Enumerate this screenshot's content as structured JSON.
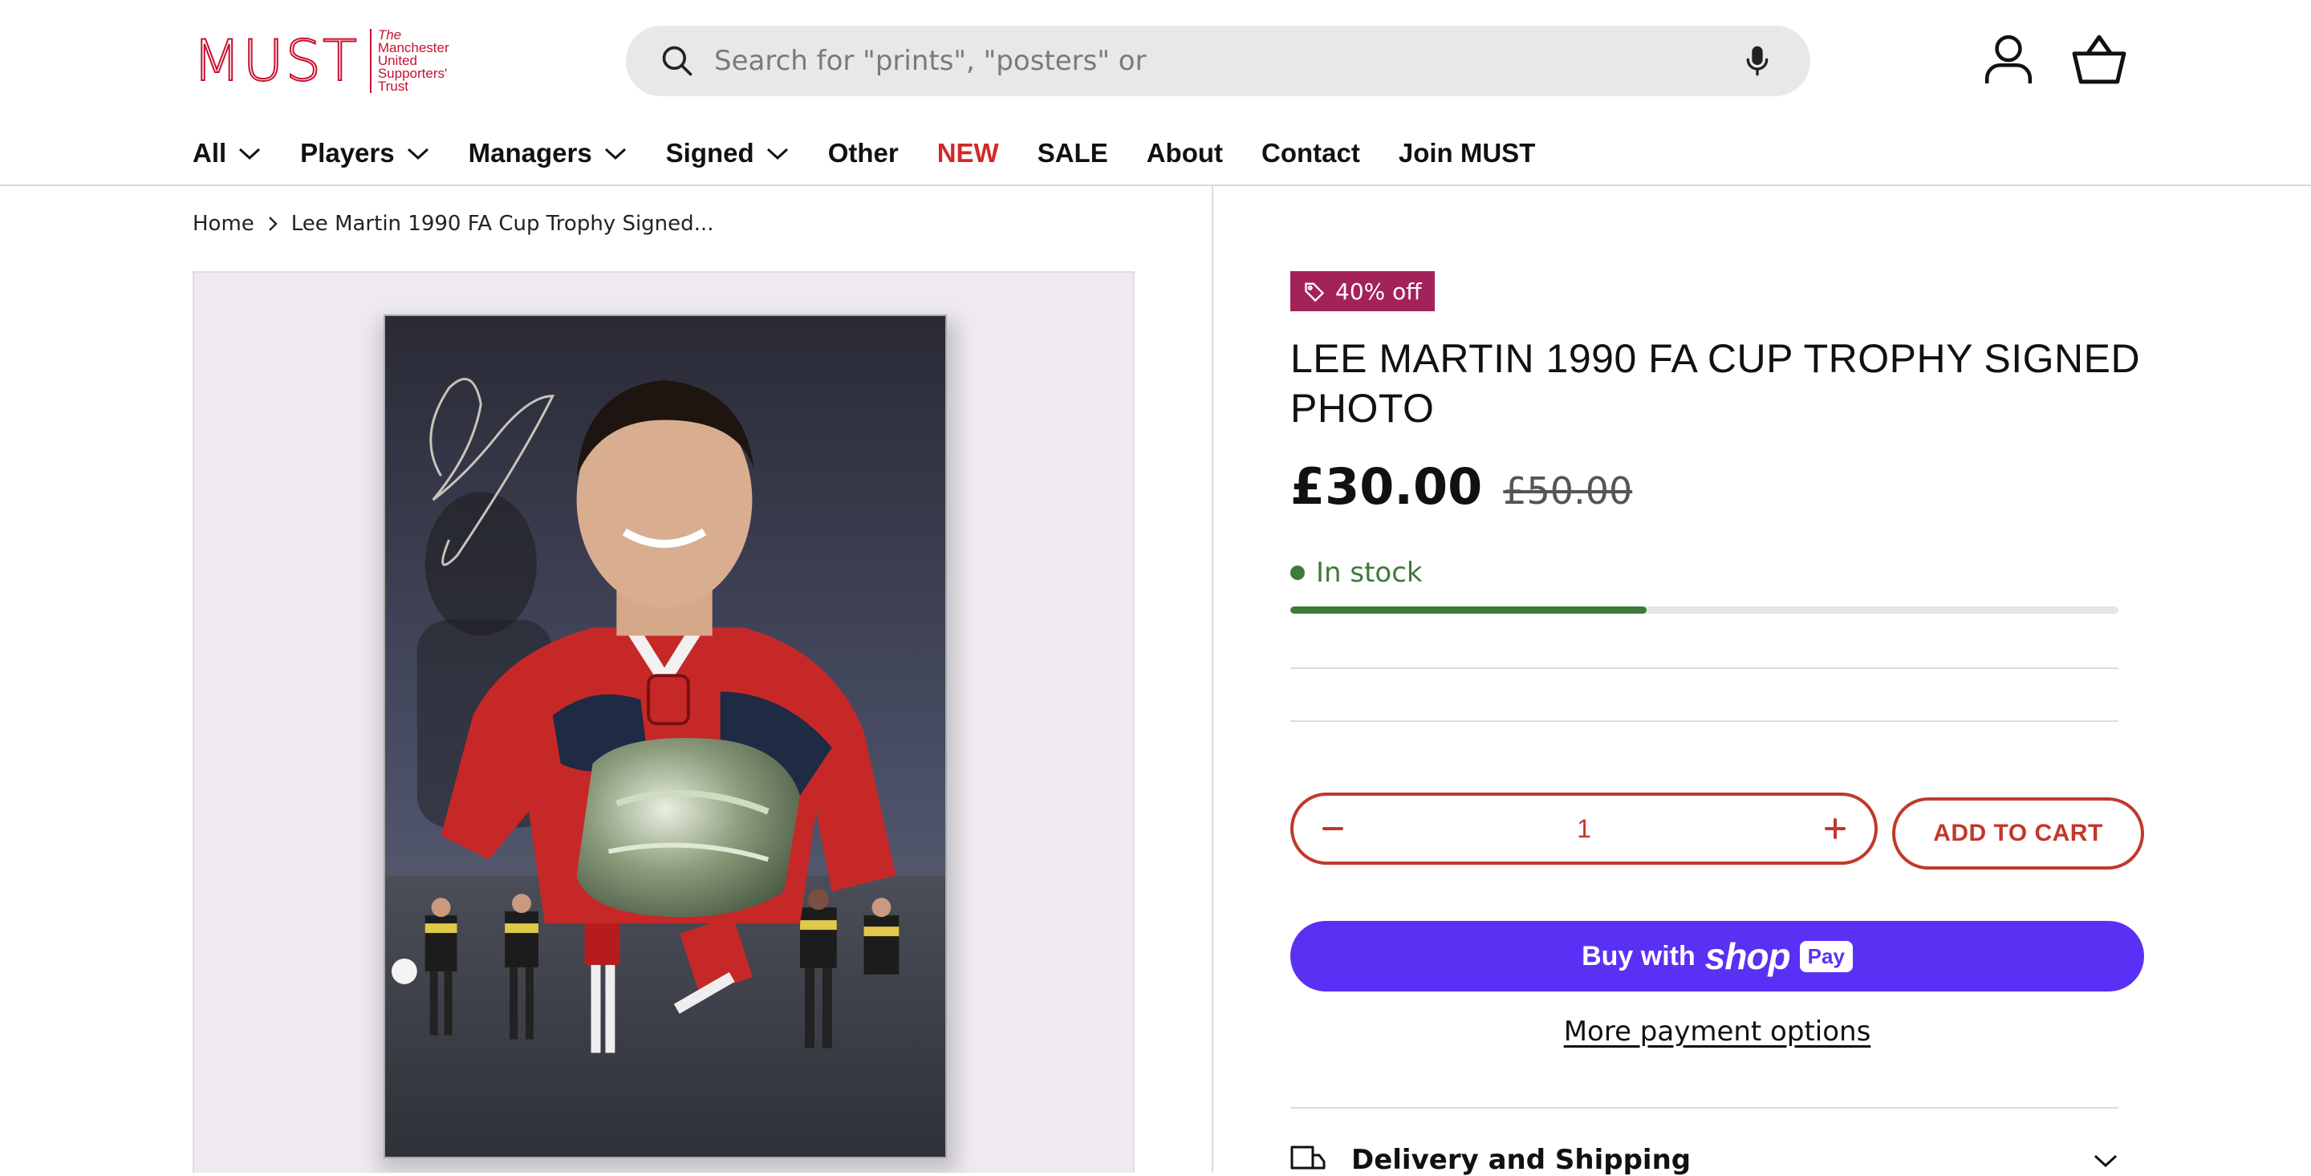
{
  "brand": {
    "logo_text": "MUST",
    "tagline": [
      "The",
      "Manchester",
      "United",
      "Supporters'",
      "Trust"
    ],
    "accent_color": "#c8102e"
  },
  "search": {
    "placeholder": "Search for \"prints\", \"posters\" or"
  },
  "nav": {
    "items": [
      {
        "label": "All",
        "has_dropdown": true
      },
      {
        "label": "Players",
        "has_dropdown": true
      },
      {
        "label": "Managers",
        "has_dropdown": true
      },
      {
        "label": "Signed",
        "has_dropdown": true
      },
      {
        "label": "Other",
        "has_dropdown": false
      },
      {
        "label": "NEW",
        "has_dropdown": false,
        "highlight_color": "#d12a2a"
      },
      {
        "label": "SALE",
        "has_dropdown": false
      },
      {
        "label": "About",
        "has_dropdown": false
      },
      {
        "label": "Contact",
        "has_dropdown": false
      },
      {
        "label": "Join MUST",
        "has_dropdown": false
      }
    ]
  },
  "breadcrumb": {
    "home": "Home",
    "current": "Lee Martin 1990 FA Cup Trophy Signed..."
  },
  "product": {
    "discount_badge": "40% off",
    "title": "LEE MARTIN 1990 FA CUP TROPHY SIGNED PHOTO",
    "price_current": "£30.00",
    "price_original": "£50.00",
    "stock_status": "In stock",
    "stock_level": 0.43,
    "stock_color": "#3e7a3a",
    "quantity": "1",
    "add_to_cart": "ADD TO CART",
    "buy_with": "Buy with",
    "shop_brand": "shop",
    "shop_pay": "Pay",
    "more_payment": "More payment options",
    "badge_color": "#a4225a",
    "shoppay_color": "#5a31f4"
  },
  "accordion": {
    "delivery_title": "Delivery and Shipping"
  }
}
